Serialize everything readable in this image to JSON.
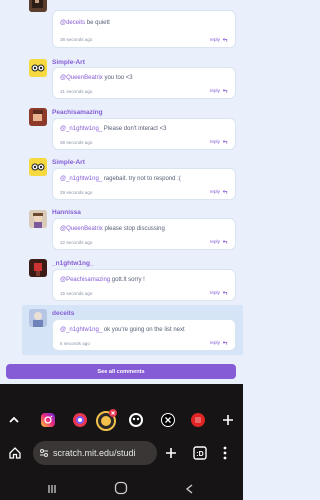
{
  "comments": [
    {
      "username": "",
      "mention": "@deceits",
      "text": " be quiett",
      "time": "38 seconds ago",
      "reply": "reply"
    },
    {
      "username": "Simple-Art",
      "mention": "@QueenBeatrix",
      "text": " you too <3",
      "time": "31 seconds ago",
      "reply": "reply"
    },
    {
      "username": "Peachisamazing",
      "mention": "@_n1ghtw1ng_",
      "text": " Please don't interact <3",
      "time": "38 seconds ago",
      "reply": "reply"
    },
    {
      "username": "Simple-Art",
      "mention": "@_n1ghtw1ng_",
      "text": " ragebait. try not to respond :(",
      "time": "29 seconds ago",
      "reply": "reply"
    },
    {
      "username": "Hannissa",
      "mention": "@QueenBeatrix",
      "text": " please stop discussing",
      "time": "22 seconds ago",
      "reply": "reply"
    },
    {
      "username": "_n1ghtw1ng_",
      "mention": "@Peachisamazing",
      "text": " gott.lt sorry !",
      "time": "15 seconds ago",
      "reply": "reply"
    },
    {
      "username": "deceits",
      "mention": "@_n1ghtw1ng_",
      "text": " ok you're going on the list next",
      "time": "5 seconds ago",
      "reply": "reply"
    }
  ],
  "see_all_label": "See all comments",
  "browser": {
    "url": "scratch.mit.edu/studi",
    "icons": [
      "chevron-up-icon",
      "instagram-icon",
      "app-icon",
      "active-tab-icon",
      "app-icon",
      "x-icon",
      "app-icon",
      "plus-icon"
    ]
  },
  "colors": {
    "accent": "#855cd6",
    "background": "#e9f0fb",
    "chrome": "#161414"
  }
}
